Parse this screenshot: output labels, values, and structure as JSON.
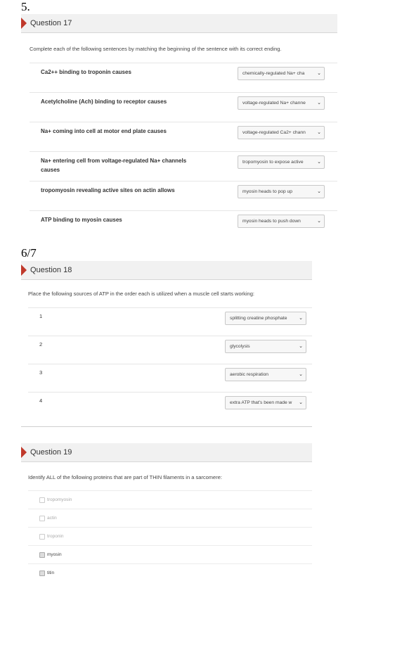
{
  "annotations": {
    "q17_number": "5.",
    "q18_score": "6/7"
  },
  "q17": {
    "title": "Question 17",
    "prompt": "Complete each of the following sentences by matching the beginning of the sentence with its correct ending.",
    "rows": [
      {
        "label": "Ca2++ binding to troponin causes",
        "selected": "chemically-regulated Na+ cha"
      },
      {
        "label": "Acetylcholine (Ach) binding to receptor causes",
        "selected": "voltage-regulated Na+ channe"
      },
      {
        "label": "Na+ coming into cell at motor end plate causes",
        "selected": "voltage-regulated Ca2+ chann"
      },
      {
        "label": "Na+ entering cell from voltage-regulated Na+ channels causes",
        "selected": "tropomyosin to expose active"
      },
      {
        "label": "tropomyosin revealing active sites on actin allows",
        "selected": "myosin heads to pop up"
      },
      {
        "label": "ATP binding to myosin causes",
        "selected": "myosin heads to push down"
      }
    ]
  },
  "q18": {
    "title": "Question 18",
    "prompt": "Place the following sources of ATP in the order each is utilized when a muscle cell starts working:",
    "rows": [
      {
        "label": "1",
        "selected": "splitting creatine phosphate"
      },
      {
        "label": "2",
        "selected": "glycolysis"
      },
      {
        "label": "3",
        "selected": "aerobic respiration"
      },
      {
        "label": "4",
        "selected": "extra ATP that's been made w"
      }
    ]
  },
  "q19": {
    "title": "Question 19",
    "prompt": "Identify ALL of the following proteins that are part of THIN filaments in a sarcomere:",
    "options": [
      {
        "label": "tropomyosin",
        "checked": false
      },
      {
        "label": "actin",
        "checked": false
      },
      {
        "label": "troponin",
        "checked": false
      },
      {
        "label": "myosin",
        "checked": true
      },
      {
        "label": "titin",
        "checked": true
      }
    ]
  },
  "icons": {
    "flag": "question-flag-icon",
    "dropdown": "chevron-down-icon",
    "checkbox": "checkbox-icon"
  },
  "colors": {
    "flag": "#c0392b",
    "header_bg": "#f1f1f1"
  }
}
